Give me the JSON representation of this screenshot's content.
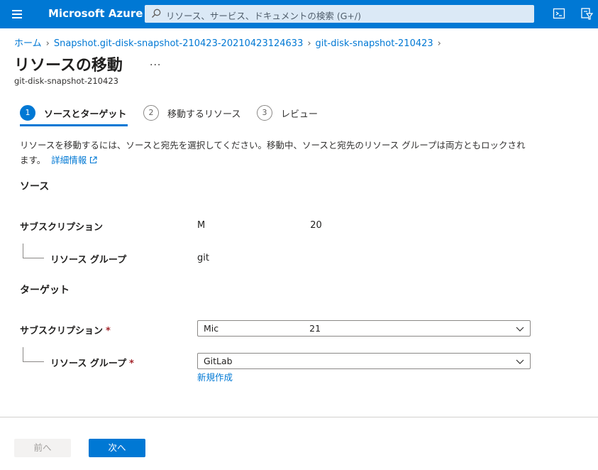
{
  "header": {
    "brand": "Microsoft Azure",
    "search_placeholder": "リソース、サービス、ドキュメントの検索 (G+/)",
    "icons": [
      "hamburger-menu-icon",
      "search-icon",
      "cloud-shell-icon",
      "directory-filter-icon"
    ]
  },
  "breadcrumb": {
    "items": [
      "ホーム",
      "Snapshot.git-disk-snapshot-210423-20210423124633",
      "git-disk-snapshot-210423"
    ]
  },
  "page": {
    "title": "リソースの移動",
    "more": "...",
    "subtitle": "git-disk-snapshot-210423"
  },
  "steps": [
    {
      "num": "1",
      "label": "ソースとターゲット",
      "active": true
    },
    {
      "num": "2",
      "label": "移動するリソース",
      "active": false
    },
    {
      "num": "3",
      "label": "レビュー",
      "active": false
    }
  ],
  "description": {
    "text": "リソースを移動するには、ソースと宛先を選択してください。移動中、ソースと宛先のリソース グループは両方ともロックされます。",
    "link": "詳細情報"
  },
  "source": {
    "heading": "ソース",
    "subscription_label": "サブスクリプション",
    "subscription_value_start": "M",
    "subscription_value_end": "20",
    "resource_group_label": "リソース グループ",
    "resource_group_value": "git"
  },
  "target": {
    "heading": "ターゲット",
    "subscription_label": "サブスクリプション",
    "required_mark": "*",
    "subscription_value_start": "Mic",
    "subscription_value_end": "21",
    "resource_group_label": "リソース グループ",
    "resource_group_value": "GitLab",
    "create_new": "新規作成"
  },
  "footer": {
    "prev": "前へ",
    "next": "次へ"
  },
  "colors": {
    "accent": "#0078d4",
    "required": "#a4262c"
  }
}
